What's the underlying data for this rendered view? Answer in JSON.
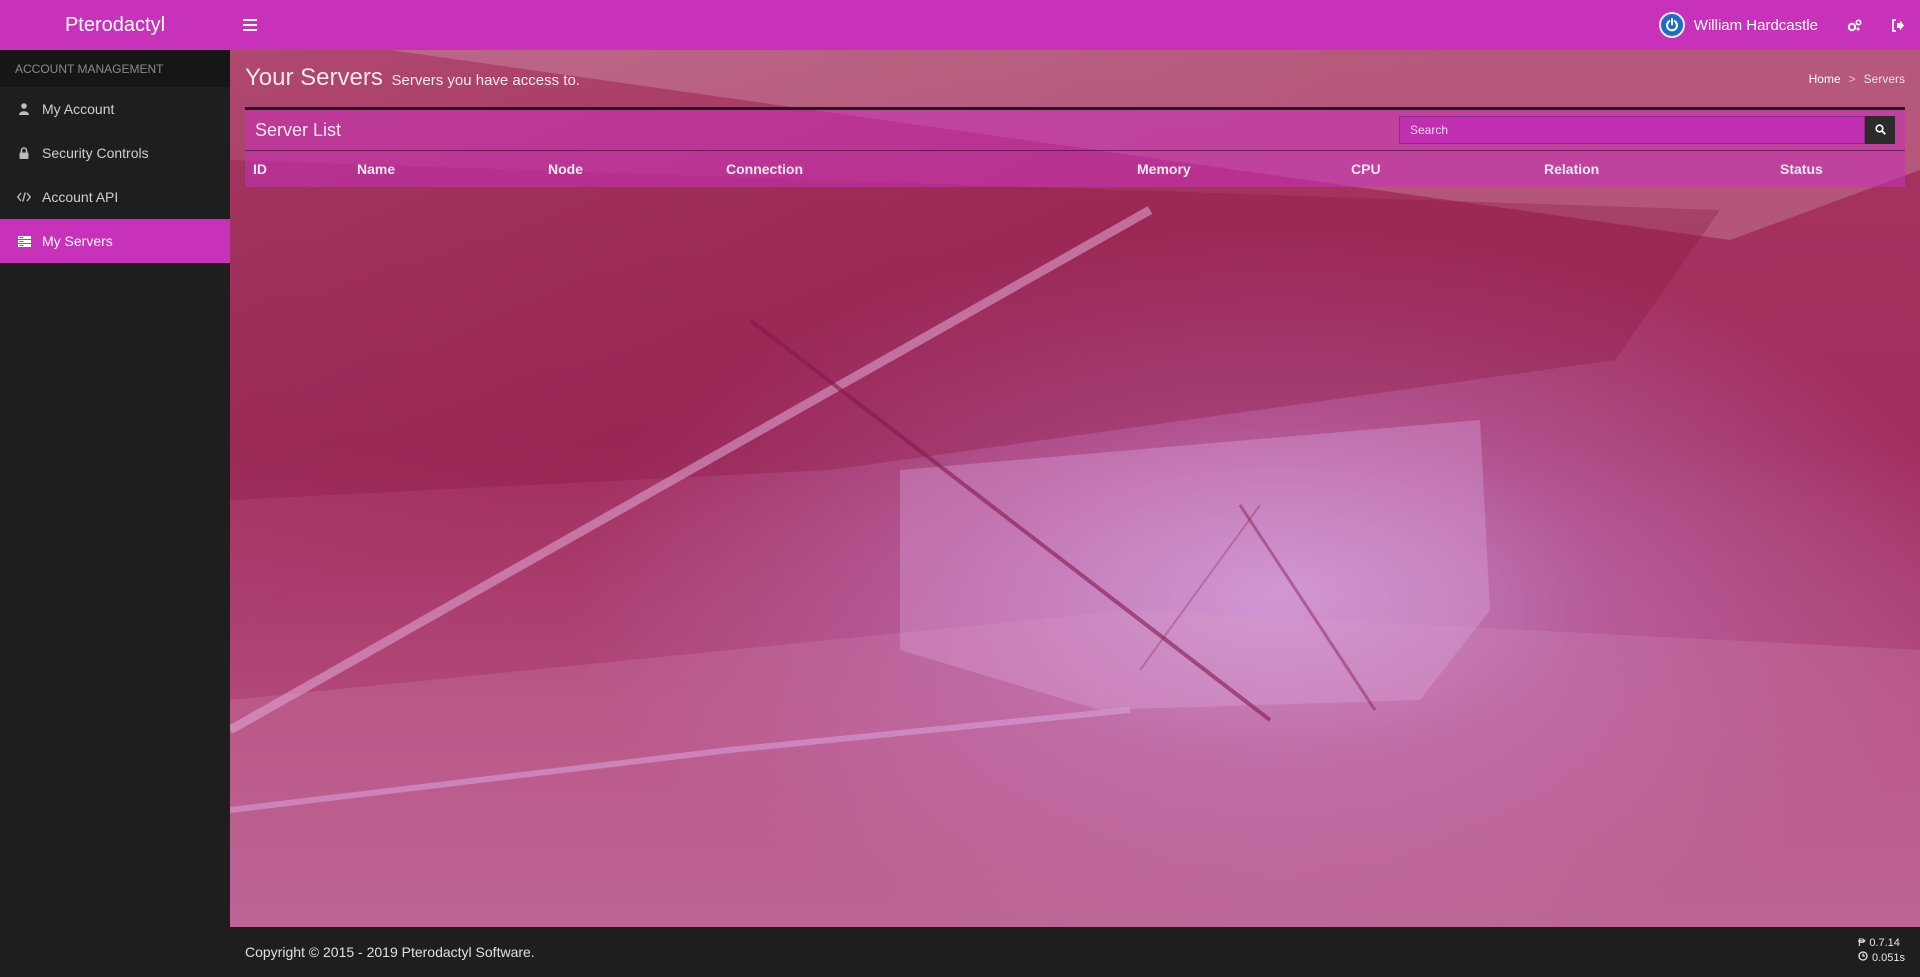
{
  "app": {
    "brand": "Pterodactyl"
  },
  "topbar": {
    "menu_icon": "hamburger-icon",
    "user_name": "William Hardcastle",
    "avatar_icon": "power-icon",
    "admin_icon": "cogs-icon",
    "logout_icon": "sign-out-icon"
  },
  "sidebar": {
    "header": "Account Management",
    "items": [
      {
        "label": "My Account",
        "icon": "user-icon",
        "active": false
      },
      {
        "label": "Security Controls",
        "icon": "lock-icon",
        "active": false
      },
      {
        "label": "Account API",
        "icon": "code-icon",
        "active": false
      },
      {
        "label": "My Servers",
        "icon": "server-icon",
        "active": true
      }
    ]
  },
  "page": {
    "title": "Your Servers",
    "subtitle": "Servers you have access to.",
    "breadcrumb": [
      "Home",
      "Servers"
    ],
    "breadcrumb_separator": ">"
  },
  "server_list": {
    "title": "Server List",
    "search_placeholder": "Search",
    "search_icon": "search-icon",
    "columns": [
      "ID",
      "Name",
      "Node",
      "Connection",
      "Memory",
      "CPU",
      "Relation",
      "Status"
    ],
    "rows": []
  },
  "footer": {
    "copyright": "Copyright © 2015 - 2019 Pterodactyl Software.",
    "version": "0.7.14",
    "render_time": "0.051s"
  },
  "colors": {
    "accent": "#c831ba",
    "sidebar_bg": "#1e1e1e",
    "sidebar_header_bg": "#161616"
  }
}
